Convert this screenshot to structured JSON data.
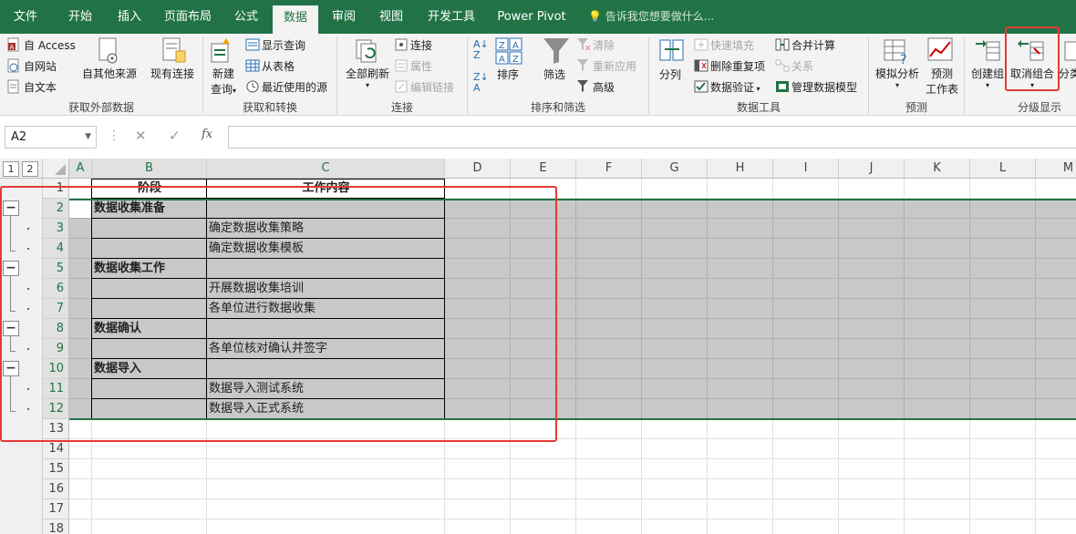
{
  "menu": {
    "tabs": [
      "文件",
      "开始",
      "插入",
      "页面布局",
      "公式",
      "数据",
      "审阅",
      "视图",
      "开发工具",
      "Power Pivot"
    ],
    "active_tab": "数据",
    "tell_me": "告诉我您想要做什么..."
  },
  "ribbon": {
    "get_external": {
      "access": "自 Access",
      "web": "自网站",
      "text": "自文本",
      "other": "自其他来源",
      "existing": "现有连接",
      "group_label": "获取外部数据"
    },
    "get_transform": {
      "new_query_line1": "新建",
      "new_query_line2": "查询",
      "show_queries": "显示查询",
      "from_table": "从表格",
      "recent_sources": "最近使用的源",
      "group_label": "获取和转换"
    },
    "connections": {
      "refresh_all": "全部刷新",
      "connections": "连接",
      "properties": "属性",
      "edit_links": "编辑链接",
      "group_label": "连接"
    },
    "sort_filter": {
      "sort": "排序",
      "filter": "筛选",
      "clear": "清除",
      "reapply": "重新应用",
      "advanced": "高级",
      "group_label": "排序和筛选"
    },
    "data_tools": {
      "split": "分列",
      "flash_fill": "快速填充",
      "remove_dup": "删除重复项",
      "validation": "数据验证",
      "consolidate": "合并计算",
      "relations": "关系",
      "data_model": "管理数据模型",
      "group_label": "数据工具"
    },
    "forecast": {
      "what_if": "模拟分析",
      "forecast_sheet_line1": "预测",
      "forecast_sheet_line2": "工作表",
      "group_label": "预测"
    },
    "outline": {
      "group": "创建组",
      "ungroup": "取消组合",
      "subtotal": "分类",
      "group_label": "分级显示"
    }
  },
  "formula_bar": {
    "name_box": "A2",
    "fx": "fx",
    "value": ""
  },
  "sheet": {
    "columns": [
      "A",
      "B",
      "C",
      "D",
      "E",
      "F",
      "G",
      "H",
      "I",
      "J",
      "K",
      "L",
      "M"
    ],
    "outline_levels": [
      "1",
      "2"
    ],
    "rows": [
      {
        "num": "1",
        "b": "阶段",
        "c": "工作内容"
      },
      {
        "num": "2",
        "b": "数据收集准备",
        "c": ""
      },
      {
        "num": "3",
        "b": "",
        "c": "确定数据收集策略"
      },
      {
        "num": "4",
        "b": "",
        "c": "确定数据收集模板"
      },
      {
        "num": "5",
        "b": "数据收集工作",
        "c": ""
      },
      {
        "num": "6",
        "b": "",
        "c": "开展数据收集培训"
      },
      {
        "num": "7",
        "b": "",
        "c": "各单位进行数据收集"
      },
      {
        "num": "8",
        "b": "数据确认",
        "c": ""
      },
      {
        "num": "9",
        "b": "",
        "c": "各单位核对确认并签字"
      },
      {
        "num": "10",
        "b": "数据导入",
        "c": ""
      },
      {
        "num": "11",
        "b": "",
        "c": "数据导入测试系统"
      },
      {
        "num": "12",
        "b": "",
        "c": "数据导入正式系统"
      },
      {
        "num": "13",
        "b": "",
        "c": ""
      },
      {
        "num": "14",
        "b": "",
        "c": ""
      },
      {
        "num": "15",
        "b": "",
        "c": ""
      },
      {
        "num": "16",
        "b": "",
        "c": ""
      },
      {
        "num": "17",
        "b": "",
        "c": ""
      },
      {
        "num": "18",
        "b": "",
        "c": ""
      }
    ]
  },
  "colors": {
    "excel_green": "#217346",
    "highlight_red": "#e53935",
    "selection_gray": "#c8c8c8"
  }
}
